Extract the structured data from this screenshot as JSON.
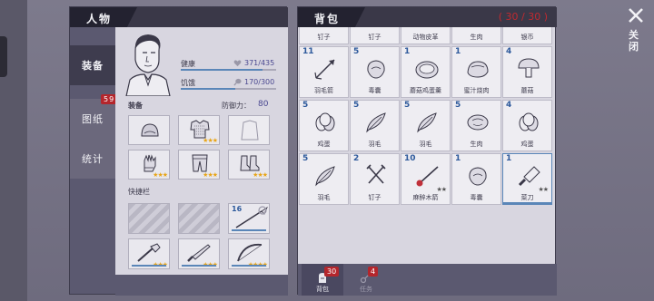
{
  "character": {
    "title": "人物",
    "tabs": [
      {
        "label": "装备"
      },
      {
        "label": "图纸",
        "badge": "59"
      },
      {
        "label": "统计"
      }
    ],
    "stats": {
      "health": {
        "label": "健康",
        "value": "371/435",
        "fraction": 0.853
      },
      "hunger": {
        "label": "饥饿",
        "value": "170/300",
        "fraction": 0.567
      }
    },
    "equipment_label": "装备",
    "defense_label": "防御力：",
    "defense_value": "80",
    "quickbar_label": "快捷栏",
    "equipment_slots": [
      {
        "icon": "helmet-icon",
        "stars": ""
      },
      {
        "icon": "chainmail-armor-icon",
        "stars": "★★★"
      },
      {
        "icon": "cloak-icon",
        "stars": ""
      },
      {
        "icon": "gauntlet-icon",
        "stars": "★★★"
      },
      {
        "icon": "leg-armor-icon",
        "stars": "★★★"
      },
      {
        "icon": "boots-icon",
        "stars": "★★★"
      }
    ],
    "quick_slots": [
      {
        "icon": "locked-icon",
        "num": ""
      },
      {
        "icon": "locked-icon",
        "num": ""
      },
      {
        "icon": "spear-icon",
        "num": "16"
      },
      {
        "icon": "torch-icon",
        "num": "",
        "stars": "★★★"
      },
      {
        "icon": "machete-icon",
        "num": "",
        "stars": "★★★"
      },
      {
        "icon": "bow-icon",
        "num": "",
        "stars": "★★★★"
      }
    ]
  },
  "bag": {
    "title": "背包",
    "capacity": "( 30 / 30 )",
    "items": [
      {
        "name": "钉子",
        "num": "",
        "icon": "nail-icon"
      },
      {
        "name": "钉子",
        "num": "",
        "icon": "nail-icon"
      },
      {
        "name": "动物皮革",
        "num": "",
        "icon": "leather-icon"
      },
      {
        "name": "生肉",
        "num": "",
        "icon": "raw-meat-icon"
      },
      {
        "name": "银币",
        "num": "",
        "icon": "silver-coin-icon"
      },
      {
        "name": "羽毛箭",
        "num": "11",
        "icon": "arrow-icon"
      },
      {
        "name": "毒囊",
        "num": "5",
        "icon": "poison-sac-icon"
      },
      {
        "name": "蘑菇鸡蛋羹",
        "num": "1",
        "icon": "mushroom-egg-soup-icon"
      },
      {
        "name": "蜜汁烧肉",
        "num": "1",
        "icon": "honey-roast-icon"
      },
      {
        "name": "蘑菇",
        "num": "4",
        "icon": "mushroom-icon"
      },
      {
        "name": "鸡蛋",
        "num": "5",
        "icon": "egg-icon"
      },
      {
        "name": "羽毛",
        "num": "5",
        "icon": "feather-icon"
      },
      {
        "name": "羽毛",
        "num": "5",
        "icon": "feather-icon"
      },
      {
        "name": "生肉",
        "num": "5",
        "icon": "raw-meat-icon"
      },
      {
        "name": "鸡蛋",
        "num": "4",
        "icon": "egg-icon"
      },
      {
        "name": "羽毛",
        "num": "5",
        "icon": "feather-icon"
      },
      {
        "name": "钉子",
        "num": "2",
        "icon": "nail-icon"
      },
      {
        "name": "麻醉木箭",
        "num": "10",
        "icon": "tranq-arrow-icon",
        "stars": "★★"
      },
      {
        "name": "毒囊",
        "num": "1",
        "icon": "poison-sac-icon"
      },
      {
        "name": "菜刀",
        "num": "1",
        "icon": "cleaver-icon",
        "stars": "★★"
      }
    ],
    "footer_tabs": [
      {
        "label": "背包",
        "badge": "30"
      },
      {
        "label": "任务",
        "badge": "4"
      }
    ]
  },
  "close_label": "关闭"
}
